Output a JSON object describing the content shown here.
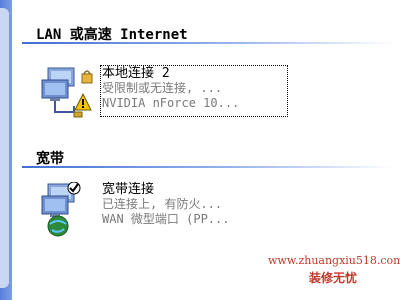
{
  "sections": [
    {
      "title": "LAN 或高速 Internet",
      "items": [
        {
          "name": "本地连接 2",
          "status": "受限制或无连接, ...",
          "device": "NVIDIA nForce 10...",
          "icon": "lan-connection-warning-icon",
          "selected": true
        }
      ]
    },
    {
      "title": "宽带",
      "items": [
        {
          "name": "宽带连接",
          "status": "已连接上, 有防火...",
          "device": "WAN 微型端口 (PP...",
          "icon": "broadband-connection-icon",
          "selected": false
        }
      ]
    }
  ],
  "watermark": {
    "url": "www.zhuangxiu518.com",
    "label": "装修无忧"
  },
  "colors": {
    "warning": "#f5c400",
    "header_rule": "#3f6fd4",
    "secondary_text": "#7a7a7a"
  }
}
